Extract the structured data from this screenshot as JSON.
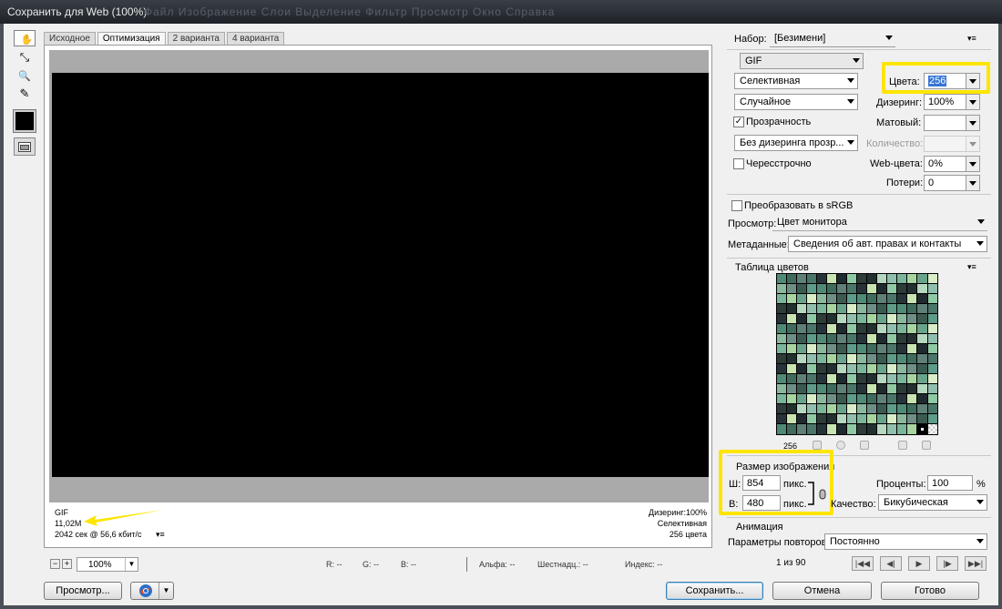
{
  "window": {
    "title": "Сохранить для Web (100%)",
    "background_menu": "Файл   Изображение   Слои   Выделение   Фильтр   Просмотр   Окно   Справка"
  },
  "tools": [
    {
      "icon": "hand-icon",
      "glyph": "✋"
    },
    {
      "icon": "slice-select-icon",
      "glyph": "⤡"
    },
    {
      "icon": "zoom-icon",
      "glyph": "🔍"
    },
    {
      "icon": "eyedropper-icon",
      "glyph": "✎"
    }
  ],
  "tabs": [
    {
      "label": "Исходное"
    },
    {
      "label": "Оптимизация",
      "active": true
    },
    {
      "label": "2 варианта"
    },
    {
      "label": "4 варианта"
    }
  ],
  "preview": {
    "left": {
      "format": "GIF",
      "size": "11,02M",
      "time": "2042 сек @ 56,6 кбит/с"
    },
    "right": {
      "dither": "Дизеринг:100%",
      "palette": "Селективная",
      "colors": "256 цвета"
    }
  },
  "statusbar": {
    "zoom": "100%",
    "r": "R: --",
    "g": "G: --",
    "b": "B: --",
    "alpha": "Альфа: --",
    "hex": "Шестнадц.: --",
    "index": "Индекс: --"
  },
  "buttons": {
    "preview": "Просмотр...",
    "save": "Сохранить...",
    "cancel": "Отмена",
    "done": "Готово"
  },
  "settings": {
    "preset_label": "Набор:",
    "preset_value": "[Безимени]",
    "format": "GIF",
    "reduction": "Селективная",
    "colors_label": "Цвета:",
    "colors_value": "256",
    "dither_algo": "Случайное",
    "dither_label": "Дизеринг:",
    "dither_value": "100%",
    "transparency": "Прозрачность",
    "transparency_checked": true,
    "matte_label": "Матовый:",
    "matte_value": "",
    "transparency_dither": "Без дизеринга прозр...",
    "amount_label": "Количество:",
    "amount_value": "",
    "interlaced": "Чересстрочно",
    "interlaced_checked": false,
    "websnap_label": "Web-цвета:",
    "websnap_value": "0%",
    "lossy_label": "Потери:",
    "lossy_value": "0",
    "srgb": "Преобразовать в sRGB",
    "preview_label": "Просмотр:",
    "preview_value": "Цвет монитора",
    "metadata_label": "Метаданные:",
    "metadata_value": "Сведения об авт. правах и контакты"
  },
  "color_table": {
    "title": "Таблица цветов",
    "count": "256"
  },
  "image_size": {
    "title": "Размер изображения",
    "w_label": "Ш:",
    "w_value": "854",
    "w_unit": "пикс.",
    "h_label": "В:",
    "h_value": "480",
    "h_unit": "пикс.",
    "percent_label": "Проценты:",
    "percent_value": "100",
    "percent_unit": "%",
    "quality_label": "Качество:",
    "quality_value": "Бикубическая"
  },
  "animation": {
    "title": "Анимация",
    "loop_label": "Параметры повторов:",
    "loop_value": "Постоянно",
    "frame": "1 из 90"
  },
  "colors": {
    "highlight": "#fde500",
    "titlebar": "#2a2e34"
  }
}
